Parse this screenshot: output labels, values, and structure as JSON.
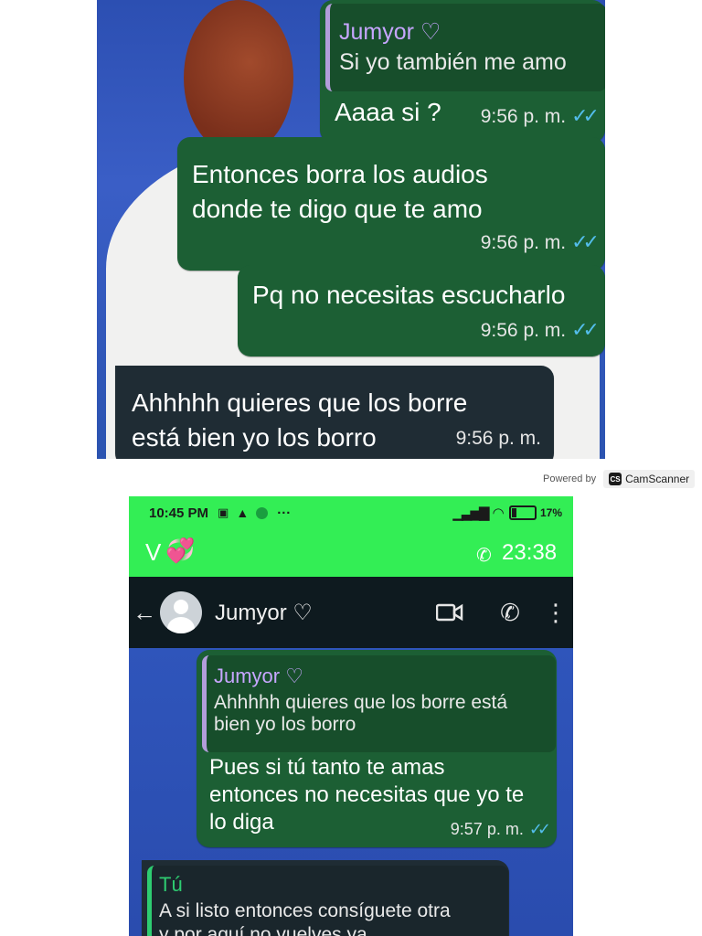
{
  "top": {
    "reply_name": "Jumyor ♡",
    "reply_text": "Si yo también me amo",
    "messages": [
      {
        "text": "Aaaa si ?",
        "time": "9:56 p. m."
      },
      {
        "text_line1": "Entonces borra los audios",
        "text_line2": "donde te digo que te amo",
        "time": "9:56 p. m."
      },
      {
        "text": "Pq no necesitas escucharlo",
        "time": "9:56 p. m."
      },
      {
        "text_line1": "Ahhhhh quieres que los borre",
        "text_line2": "está bien yo los borro",
        "time": "9:56 p. m."
      }
    ],
    "ticks": "✓✓"
  },
  "watermark": {
    "powered_by": "Powered by",
    "brand": "CamScanner",
    "logo": "CS"
  },
  "bottom": {
    "status": {
      "time": "10:45 PM",
      "more": "···",
      "battery_pct": "17%"
    },
    "call": {
      "name": "V",
      "emoji": "💞",
      "duration": "23:38"
    },
    "header": {
      "contact": "Jumyor ♡"
    },
    "msg1": {
      "reply_name": "Jumyor ♡",
      "reply_line1": "Ahhhhh quieres que los borre está",
      "reply_line2": "bien yo los borro",
      "line1": "Pues si tú tanto te amas",
      "line2": "entonces no necesitas que yo te",
      "line3": "lo diga",
      "time": "9:57 p. m."
    },
    "msg2": {
      "reply_name": "Tú",
      "reply_line1": "A si listo entonces consíguete otra",
      "reply_line2": "y por aquí no vuelves ya"
    }
  },
  "colors": {
    "outgoing_bubble": "#1c5f34",
    "incoming_bubble": "#1f2c34",
    "status_green": "#33ee55",
    "tick_blue": "#53bdeb",
    "reply_name": "#c7a6ff"
  }
}
